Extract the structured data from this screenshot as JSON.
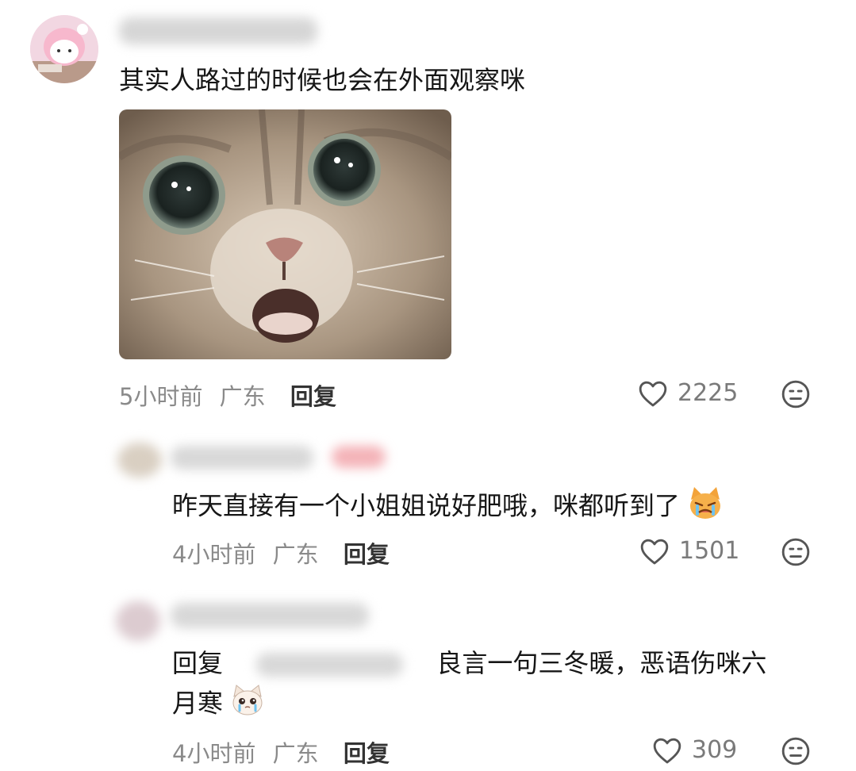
{
  "comments": [
    {
      "text": "其实人路过的时候也会在外面观察咪",
      "time": "5小时前",
      "location": "广东",
      "reply_label": "回复",
      "likes": "2225"
    },
    {
      "text": "昨天直接有一个小姐姐说好肥哦，咪都听到了",
      "time": "4小时前",
      "location": "广东",
      "reply_label": "回复",
      "likes": "1501",
      "emoji": "crying-cat-emoji"
    },
    {
      "prefix": "回复",
      "text_line1": "良言一句三冬暖，恶语伤咪六",
      "text_line2": "月寒",
      "time": "4小时前",
      "location": "广东",
      "reply_label": "回复",
      "likes": "309",
      "emoji": "crying-kitten-emoji"
    }
  ],
  "icons": {
    "like": "heart-outline-icon",
    "reaction": "neutral-face-icon"
  },
  "colors": {
    "text": "#161616",
    "meta": "#8a8a8a",
    "icon": "#555555"
  }
}
